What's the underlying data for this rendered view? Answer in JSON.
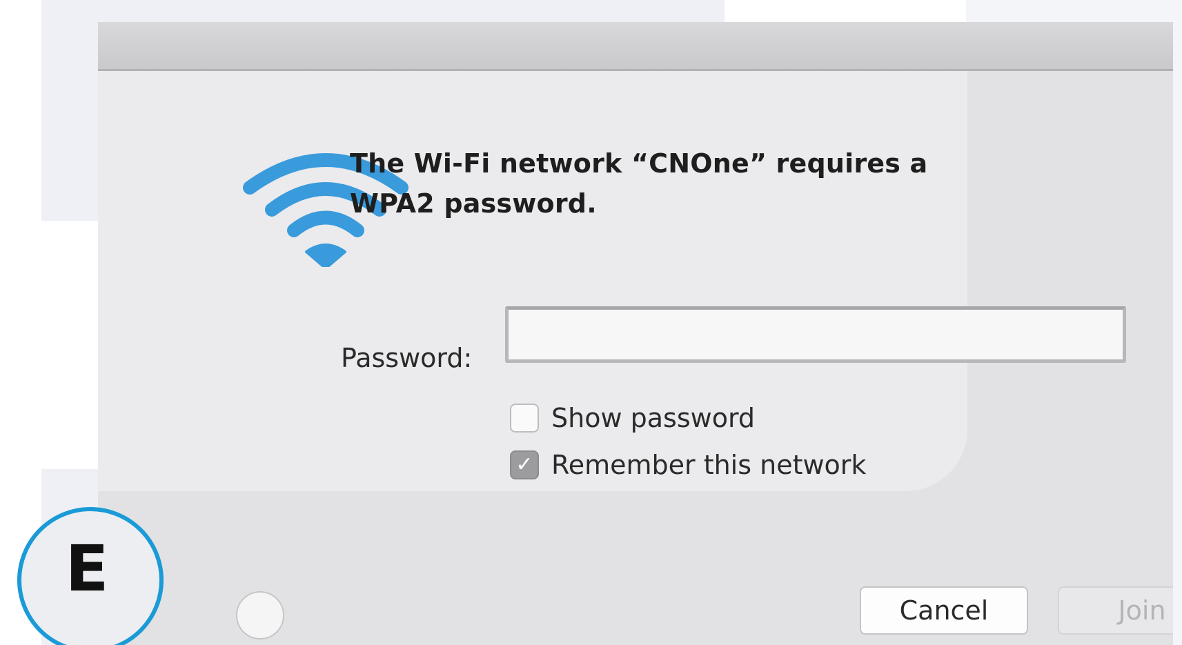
{
  "dialog": {
    "message_line1": "The Wi-Fi network “CNOne” requires a",
    "message_line2": "WPA2 password.",
    "icon": "wifi-icon",
    "accent_color": "#3a9bdc"
  },
  "password": {
    "label": "Password:",
    "value": "",
    "placeholder": ""
  },
  "options": {
    "show_password": {
      "label": "Show password",
      "checked": false
    },
    "remember_network": {
      "label": "Remember this network",
      "checked": true
    }
  },
  "buttons": {
    "cancel_label": "Cancel",
    "join_label": "Join",
    "join_enabled": false
  },
  "badge": {
    "letter": "E",
    "color": "#1a9bd7"
  }
}
